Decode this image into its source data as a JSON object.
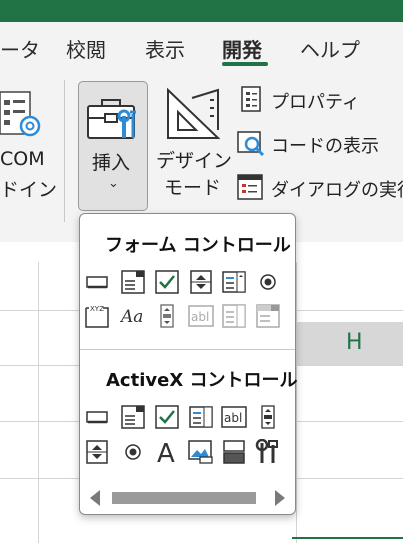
{
  "ribbon_tabs": [
    "ータ",
    "校閲",
    "表示",
    "開発",
    "ヘルプ"
  ],
  "active_tab": "開発",
  "ribbon": {
    "com_line1": "COM",
    "com_line2": "ドイン",
    "insert_label": "挿入",
    "design_line1": "デザイン",
    "design_line2": "モード",
    "properties": "プロパティ",
    "view_code": "コードの表示",
    "run_dialog": "ダイアログの実行"
  },
  "popup": {
    "form_controls_title": "フォーム コントロール",
    "activex_controls_title": "ActiveX コントロール",
    "form_controls": [
      "button",
      "combo-box",
      "checkbox",
      "spin-button",
      "list-box",
      "option-button",
      "group-box",
      "label",
      "scroll-bar",
      "text-field",
      "combo-list-edit",
      "combo-drop-down-edit"
    ],
    "activex_controls": [
      "command-button",
      "combo-box",
      "checkbox",
      "list-box",
      "text-box",
      "scroll-bar",
      "spin-button",
      "option-button",
      "label",
      "image",
      "toggle-button",
      "more-controls"
    ]
  },
  "column_header": "H",
  "colors": {
    "accent": "#217346",
    "checkbox_green": "#217346",
    "blue": "#2e8bd6"
  }
}
